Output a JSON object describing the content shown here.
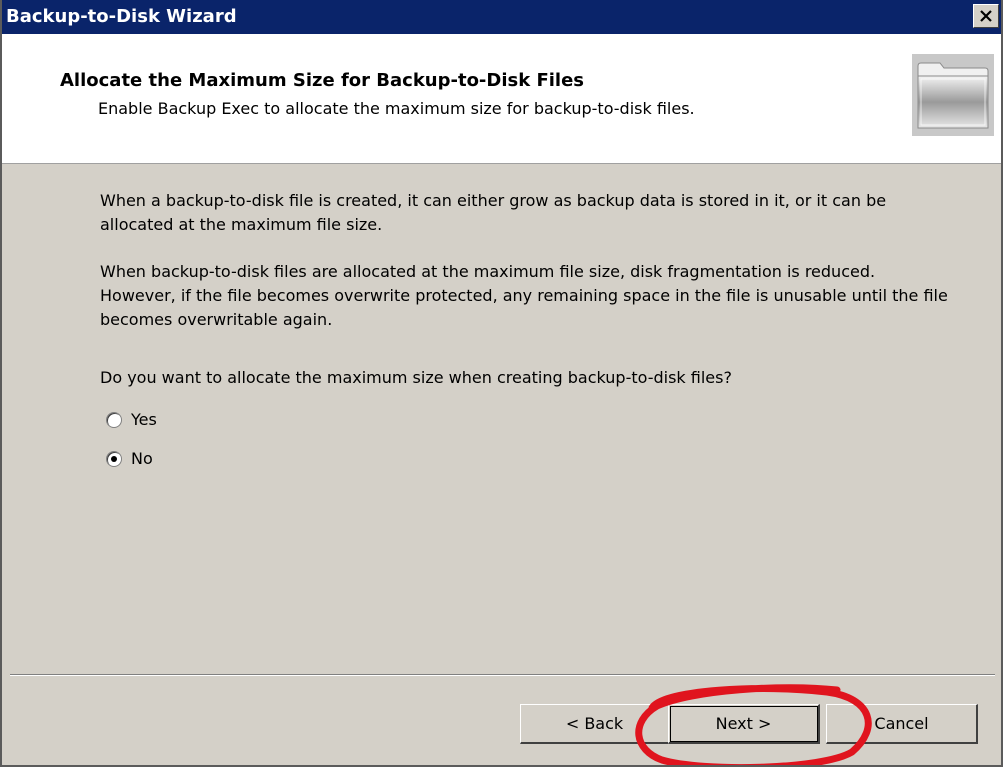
{
  "window": {
    "title": "Backup-to-Disk Wizard",
    "close_glyph": "✕"
  },
  "header": {
    "title": "Allocate the Maximum Size for Backup-to-Disk Files",
    "subtitle": "Enable Backup Exec to allocate the maximum size for backup-to-disk files.",
    "icon": "folder-icon"
  },
  "content": {
    "paragraph1": "When a backup-to-disk file is created, it can either grow as backup data is stored in it, or it can be allocated at the maximum file size.",
    "paragraph2": "When backup-to-disk files are allocated at the maximum file size, disk fragmentation is reduced. However, if the file becomes overwrite protected, any remaining space in the file is unusable until the file becomes overwritable again.",
    "question": "Do you want to allocate the maximum size when creating backup-to-disk files?",
    "options": [
      {
        "label": "Yes",
        "selected": false
      },
      {
        "label": "No",
        "selected": true
      }
    ]
  },
  "buttons": {
    "back": "< Back",
    "next": "Next >",
    "cancel": "Cancel"
  },
  "colors": {
    "title_bar": "#0a246a",
    "face": "#d4d0c8",
    "annotation_circle": "#e0141e"
  }
}
